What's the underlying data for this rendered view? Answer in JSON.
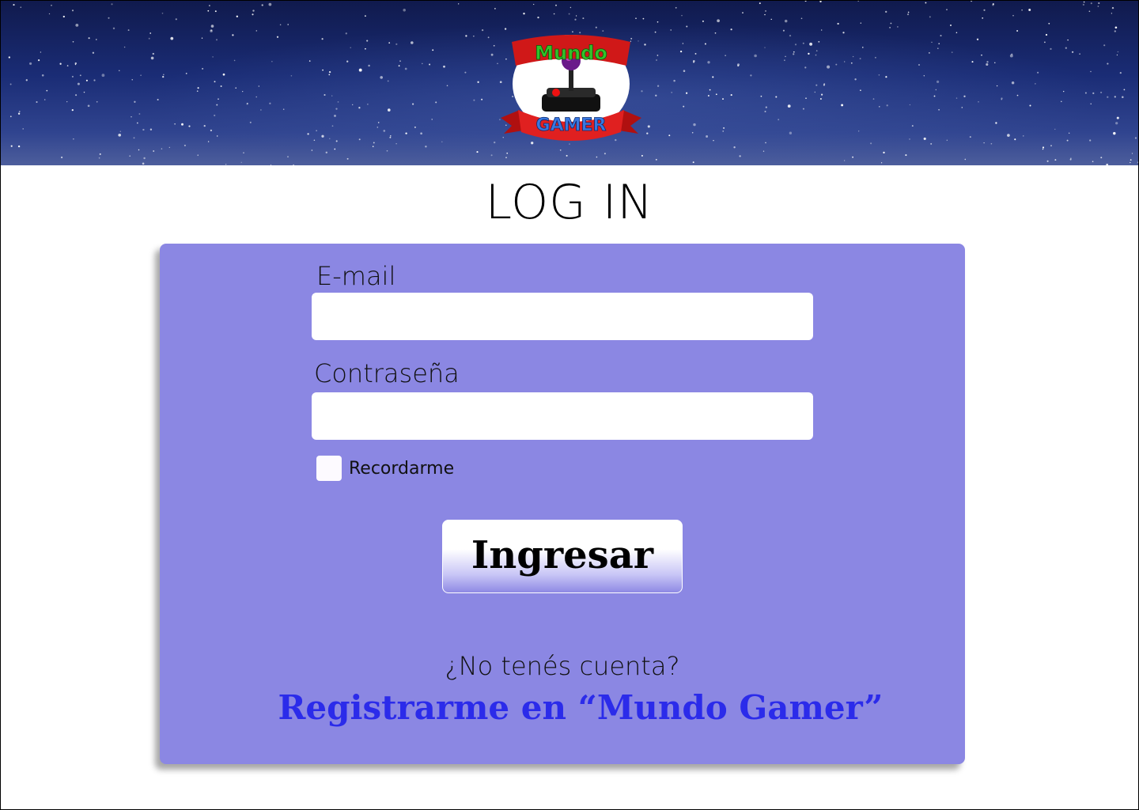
{
  "header": {
    "logo": {
      "icon": "joystick-icon",
      "banner_top_text": "Mundo",
      "banner_bottom_text": "GAMER"
    }
  },
  "page_title": "LOG IN",
  "form": {
    "email_label": "E-mail",
    "email_value": "",
    "password_label": "Contraseña",
    "password_value": "",
    "remember_label": "Recordarme",
    "remember_checked": false,
    "submit_label": "Ingresar",
    "no_account_text": "¿No tenés cuenta?",
    "register_link": "Registrarme en “Mundo Gamer”"
  },
  "colors": {
    "card_background": "#8b87e3",
    "link": "#2b2bea",
    "header_sky": "#1a2c75"
  }
}
